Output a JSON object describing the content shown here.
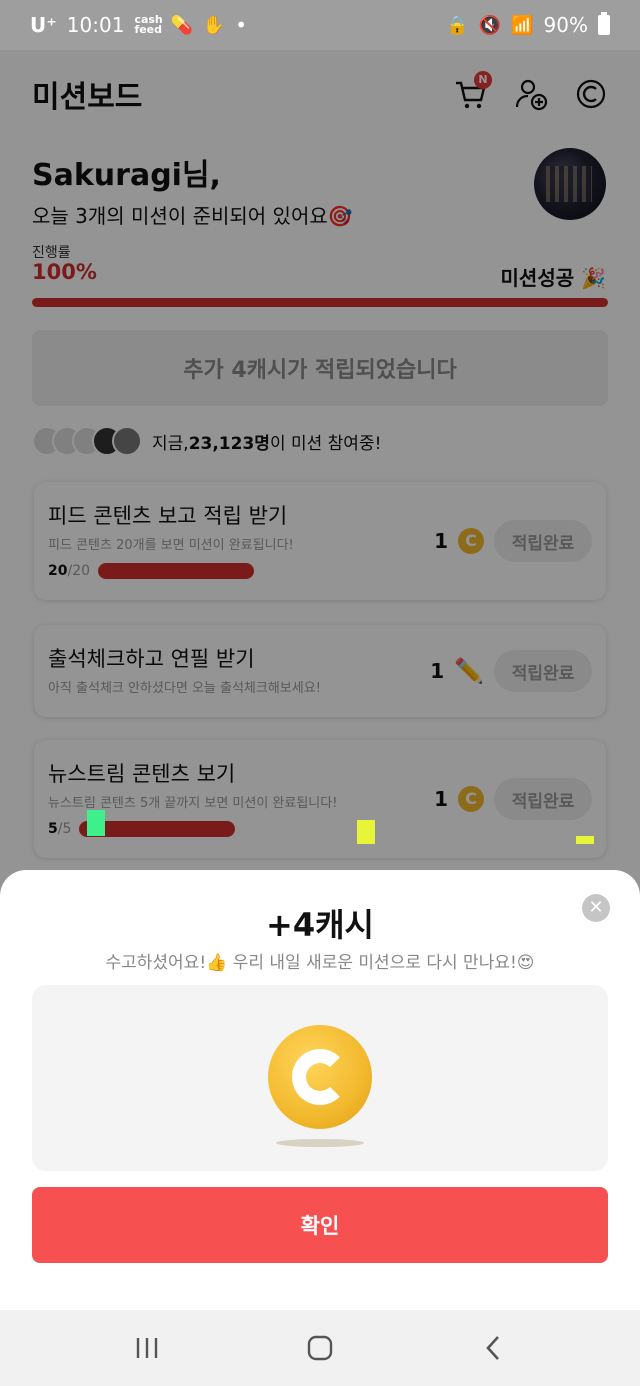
{
  "status_bar": {
    "carrier": "U⁺",
    "time": "10:01",
    "app_badge": "cash feed",
    "battery": "90%"
  },
  "header": {
    "title": "미션보드",
    "cart_badge": "N"
  },
  "greeting": {
    "name": "Sakuragi님,",
    "subtitle": "오늘 3개의 미션이 준비되어 있어요🎯"
  },
  "progress": {
    "label": "진행률",
    "value_text": "100%",
    "fraction": 1.0,
    "status": "미션성공 🎉"
  },
  "banner": {
    "text": "추가 4캐시가 적립되었습니다"
  },
  "participants": {
    "text_prefix": "지금, ",
    "count": "23,123명",
    "text_suffix": "이 미션 참여중!"
  },
  "missions": [
    {
      "title": "피드 콘텐츠 보고 적립 받기",
      "desc": "피드 콘텐츠 20개를 보면 미션이 완료됩니다!",
      "done": "20",
      "total": "/20",
      "reward": "1",
      "icon": "coin-icon",
      "button": "적립완료"
    },
    {
      "title": "출석체크하고 연필 받기",
      "desc": "아직 출석체크 안하셨다면 오늘 출석체크해보세요!",
      "reward": "1",
      "icon": "pencil-icon",
      "button": "적립완료"
    },
    {
      "title": "뉴스트림 콘텐츠 보기",
      "desc": "뉴스트림 콘텐츠 5개 끝까지 보면 미션이 완료됩니다!",
      "done": "5",
      "total": "/5",
      "reward": "1",
      "icon": "coin-icon",
      "button": "적립완료"
    }
  ],
  "sheet": {
    "title": "+4캐시",
    "message": "수고하셨어요!👍 우리 내일 새로운 미션으로 다시 만나요!😍",
    "confirm": "확인"
  },
  "colors": {
    "accent_red": "#d32f2f",
    "confirm_red": "#f75050",
    "coin_gold": "#f2b92e"
  }
}
